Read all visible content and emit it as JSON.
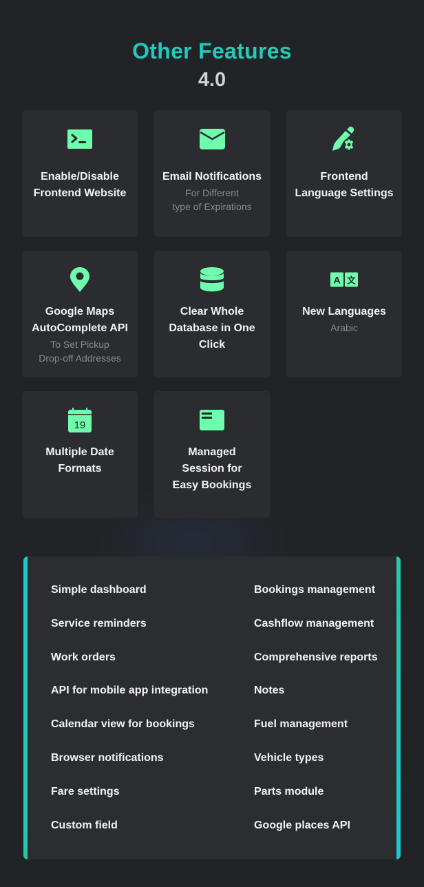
{
  "header": {
    "title": "Other Features",
    "version": "4.0"
  },
  "colors": {
    "accent_teal": "#1bc6cf",
    "accent_green": "#2ccfa8",
    "icon_green": "#6ffcad",
    "card_bg": "#2b2c30",
    "page_bg": "#222327"
  },
  "features": [
    {
      "icon": "terminal-icon",
      "title": "Enable/Disable Frontend Website",
      "title_lines": [
        "Enable/Disable",
        "Frontend Website"
      ],
      "subtitle_lines": []
    },
    {
      "icon": "envelope-icon",
      "title": "Email Notifications",
      "title_lines": [
        "Email Notifications"
      ],
      "subtitle_lines": [
        "For Different",
        "type of Expirations"
      ]
    },
    {
      "icon": "pen-gear-icon",
      "title": "Frontend Language Settings",
      "title_lines": [
        "Frontend",
        "Language Settings"
      ],
      "subtitle_lines": []
    },
    {
      "icon": "map-pin-icon",
      "title": "Google Maps AutoComplete API",
      "title_lines": [
        "Google Maps",
        "AutoComplete API"
      ],
      "subtitle_lines": [
        "To Set Pickup",
        "Drop-off Addresses"
      ]
    },
    {
      "icon": "database-icon",
      "title": "Clear Whole Database in One Click",
      "title_lines": [
        "Clear Whole",
        "Database in One",
        "Click"
      ],
      "subtitle_lines": []
    },
    {
      "icon": "translate-icon",
      "title": "New Languages",
      "title_lines": [
        "New Languages"
      ],
      "subtitle_lines": [
        "Arabic"
      ]
    },
    {
      "icon": "calendar-icon",
      "title": "Multiple Date Formats",
      "title_lines": [
        "Multiple Date",
        "Formats"
      ],
      "subtitle_lines": [],
      "icon_text": "19"
    },
    {
      "icon": "session-card-icon",
      "title": "Managed Session for Easy Bookings",
      "title_lines": [
        "Managed",
        "Session for",
        "Easy Bookings"
      ],
      "subtitle_lines": []
    }
  ],
  "feature_list": {
    "left": [
      "Simple dashboard",
      "Service reminders",
      "Work orders",
      "API for mobile app integration",
      "Calendar view for bookings",
      "Browser notifications",
      "Fare settings",
      "Custom field"
    ],
    "right": [
      "Bookings management",
      "Cashflow management",
      "Comprehensive reports",
      "Notes",
      "Fuel management",
      "Vehicle types",
      "Parts module",
      "Google places API"
    ]
  }
}
